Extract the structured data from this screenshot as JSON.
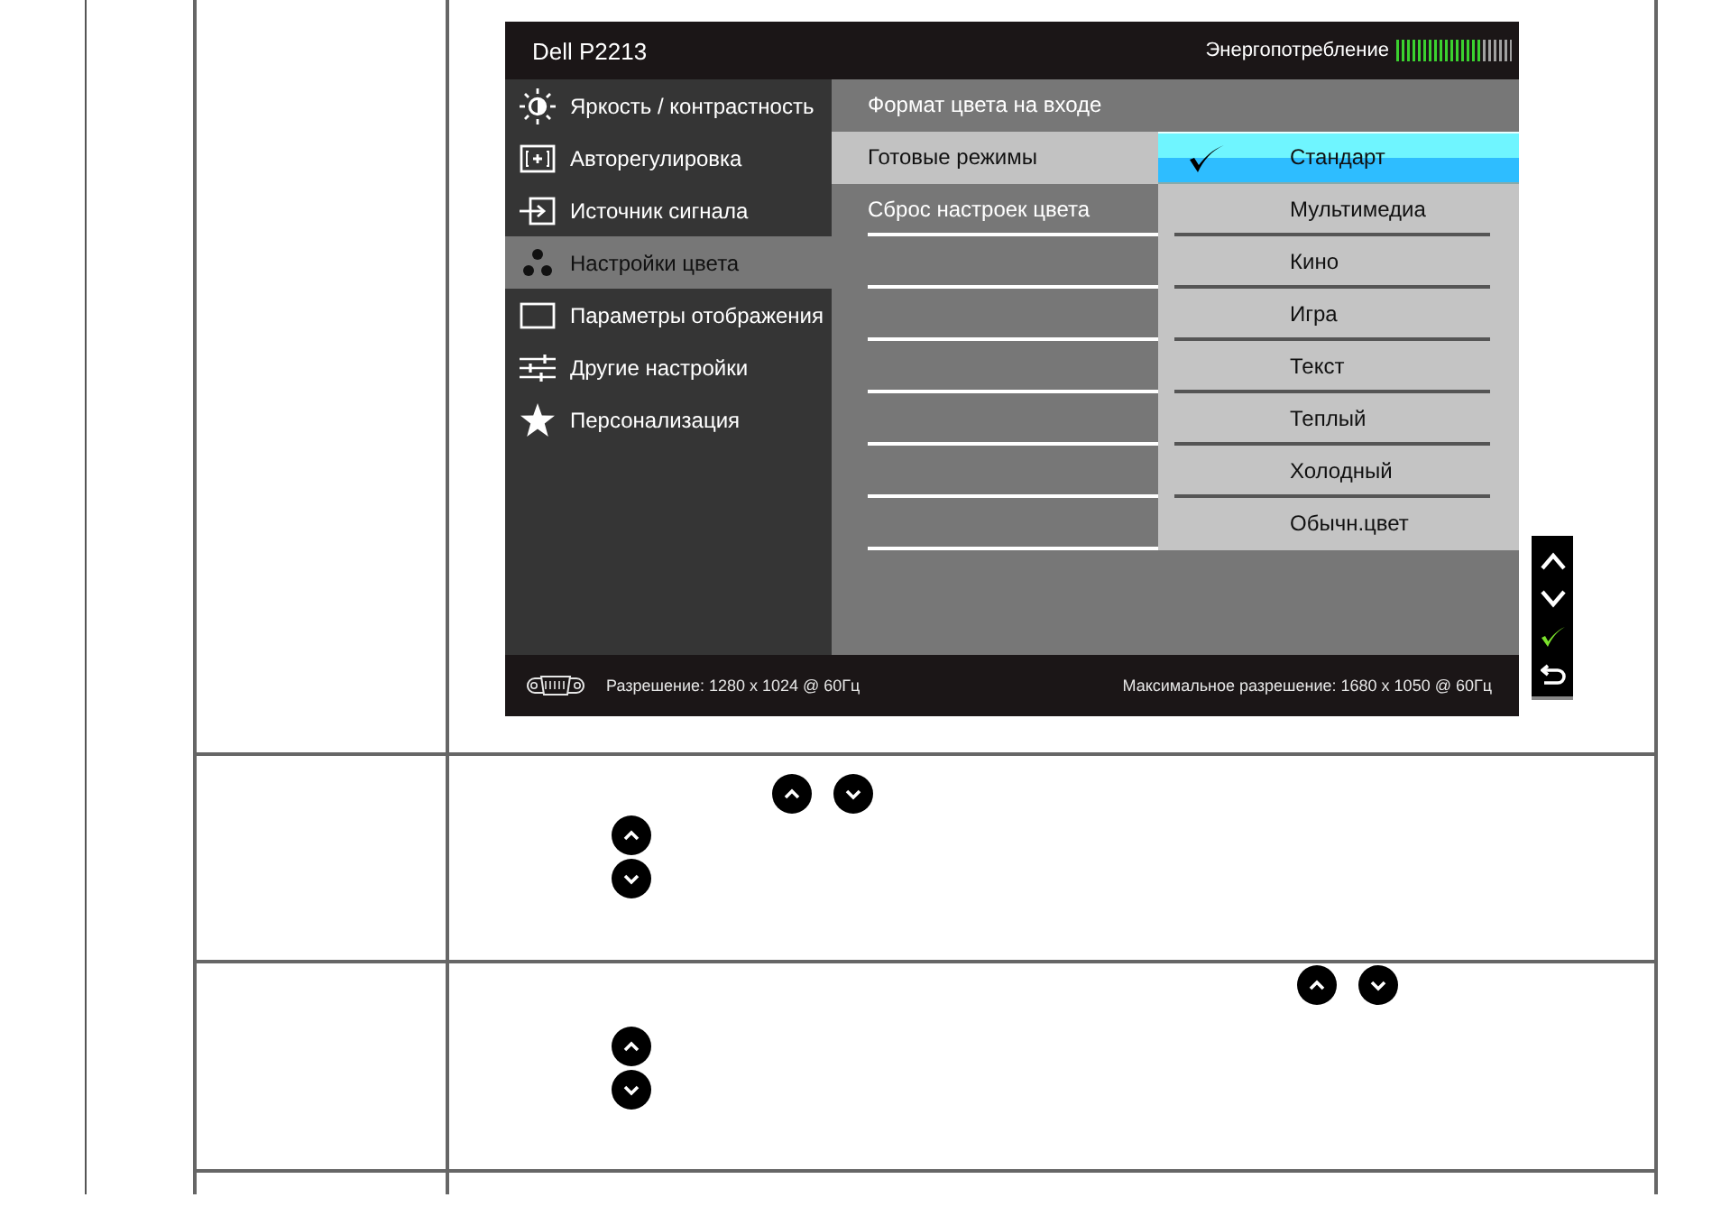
{
  "osd": {
    "title": "Dell P2213",
    "power": {
      "label": "Энергопотребление",
      "level": 0.75
    },
    "menu": [
      {
        "kind": "brightness",
        "label": "Яркость / контрастность",
        "selected": false
      },
      {
        "kind": "auto_adjust",
        "label": "Авторегулировка",
        "selected": false
      },
      {
        "kind": "input",
        "label": "Источник сигнала",
        "selected": false
      },
      {
        "kind": "color",
        "label": "Настройки цвета",
        "selected": true
      },
      {
        "kind": "display",
        "label": "Параметры отображения",
        "selected": false
      },
      {
        "kind": "other",
        "label": "Другие настройки",
        "selected": false
      },
      {
        "kind": "personalize",
        "label": "Персонализация",
        "selected": false
      }
    ],
    "submenu": [
      {
        "label": "Формат цвета на входе",
        "selected": false
      },
      {
        "label": "Готовые режимы",
        "selected": true
      },
      {
        "label": "Сброс настроек цвета",
        "selected": false
      }
    ],
    "presets": [
      {
        "label": "Стандарт",
        "selected": true
      },
      {
        "label": "Мультимедиа",
        "selected": false
      },
      {
        "label": "Кино",
        "selected": false
      },
      {
        "label": "Игра",
        "selected": false
      },
      {
        "label": "Текст",
        "selected": false
      },
      {
        "label": "Теплый",
        "selected": false
      },
      {
        "label": "Холодный",
        "selected": false
      },
      {
        "label": "Обычн.цвет",
        "selected": false
      }
    ],
    "status": {
      "resolution": "Разрешение: 1280 x 1024 @ 60Гц",
      "max_resolution": "Максимальное разрешение: 1680 x 1050 @ 60Гц"
    }
  }
}
